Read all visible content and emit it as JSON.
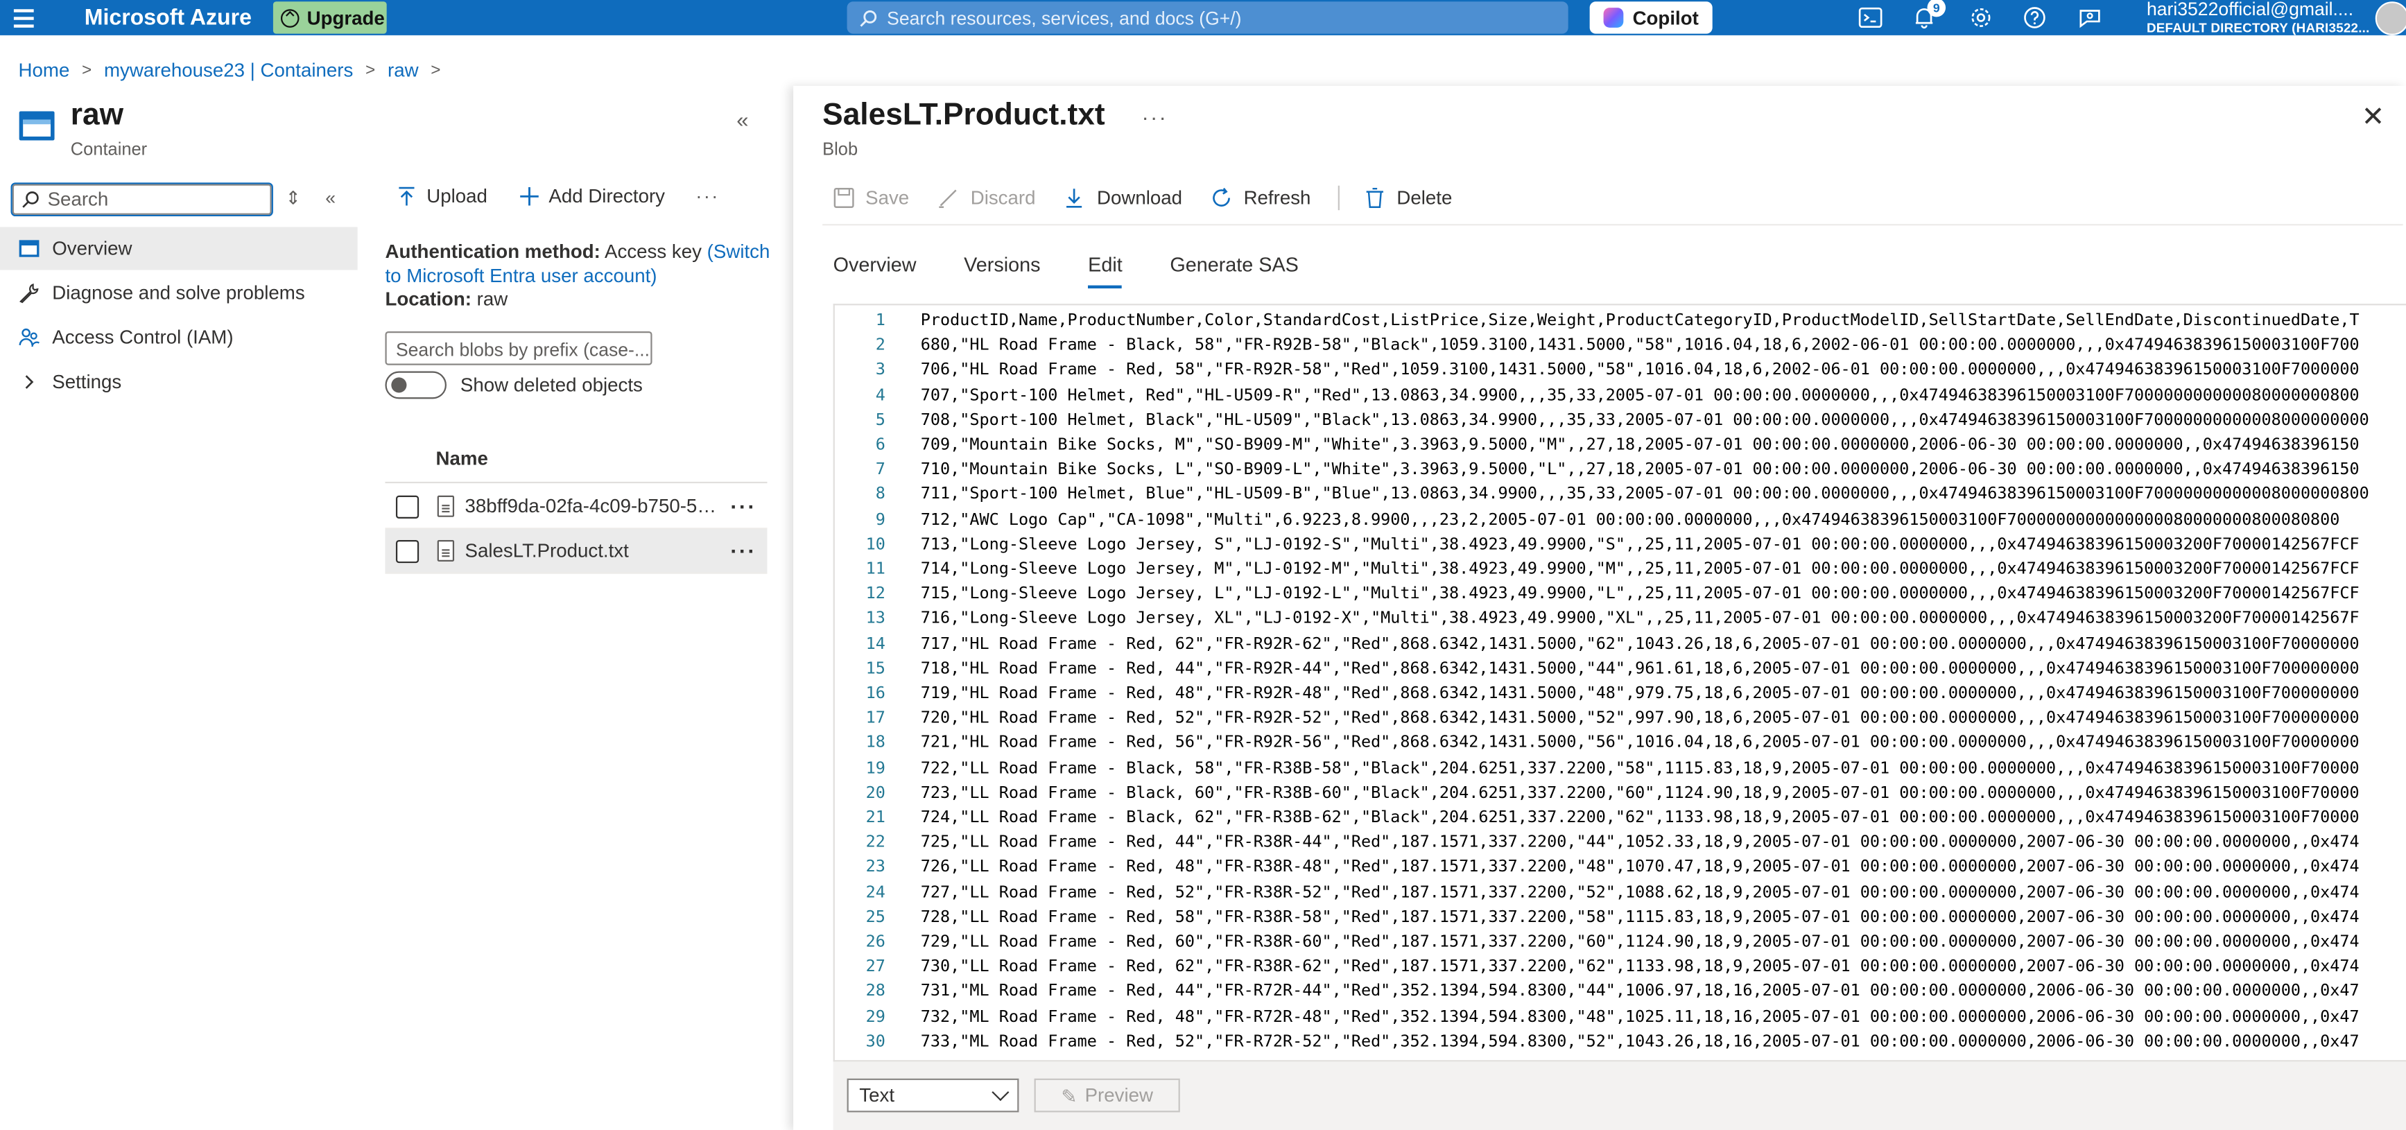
{
  "topbar": {
    "brand": "Microsoft Azure",
    "upgrade_label": "Upgrade",
    "search_placeholder": "Search resources, services, and docs (G+/)",
    "copilot_label": "Copilot",
    "notification_count": "9",
    "account_email": "hari3522official@gmail....",
    "account_directory": "DEFAULT DIRECTORY (HARI3522..."
  },
  "breadcrumb": [
    "Home",
    "mywarehouse23 | Containers",
    "raw"
  ],
  "container": {
    "title": "raw",
    "subtitle": "Container"
  },
  "leftnav": {
    "search_placeholder": "Search",
    "items": [
      {
        "label": "Overview",
        "icon": "container-icon"
      },
      {
        "label": "Diagnose and solve problems",
        "icon": "wrench-icon"
      },
      {
        "label": "Access Control (IAM)",
        "icon": "people-icon"
      },
      {
        "label": "Settings",
        "icon": "chevron-right-icon"
      }
    ]
  },
  "middle": {
    "upload_label": "Upload",
    "add_directory_label": "Add Directory",
    "auth_label": "Authentication method:",
    "auth_value": "Access key",
    "auth_link": "(Switch to Microsoft Entra user account)",
    "location_label": "Location:",
    "location_value": "raw",
    "blob_search_placeholder": "Search blobs by prefix (case-...",
    "show_deleted_label": "Show deleted objects",
    "list_header": "Name",
    "files": [
      {
        "name": "38bff9da-02fa-4c09-b750-5ee...",
        "selected": false
      },
      {
        "name": "SalesLT.Product.txt",
        "selected": true
      }
    ]
  },
  "blade": {
    "title": "SalesLT.Product.txt",
    "subtitle": "Blob",
    "toolbar": {
      "save": "Save",
      "discard": "Discard",
      "download": "Download",
      "refresh": "Refresh",
      "delete": "Delete"
    },
    "tabs": [
      "Overview",
      "Versions",
      "Edit",
      "Generate SAS"
    ],
    "active_tab": "Edit",
    "format_value": "Text",
    "preview_label": "Preview",
    "lines": [
      "ProductID,Name,ProductNumber,Color,StandardCost,ListPrice,Size,Weight,ProductCategoryID,ProductModelID,SellStartDate,SellEndDate,DiscontinuedDate,T",
      "680,\"HL Road Frame - Black, 58\",\"FR-R92B-58\",\"Black\",1059.3100,1431.5000,\"58\",1016.04,18,6,2002-06-01 00:00:00.0000000,,,0x47494638396150003100F700",
      "706,\"HL Road Frame - Red, 58\",\"FR-R92R-58\",\"Red\",1059.3100,1431.5000,\"58\",1016.04,18,6,2002-06-01 00:00:00.0000000,,,0x47494638396150003100F7000000",
      "707,\"Sport-100 Helmet, Red\",\"HL-U509-R\",\"Red\",13.0863,34.9900,,,35,33,2005-07-01 00:00:00.0000000,,,0x47494638396150003100F700000000000080000000800",
      "708,\"Sport-100 Helmet, Black\",\"HL-U509\",\"Black\",13.0863,34.9900,,,35,33,2005-07-01 00:00:00.0000000,,,0x47494638396150003100F70000000000008000000000",
      "709,\"Mountain Bike Socks, M\",\"SO-B909-M\",\"White\",3.3963,9.5000,\"M\",,27,18,2005-07-01 00:00:00.0000000,2006-06-30 00:00:00.0000000,,0x47494638396150",
      "710,\"Mountain Bike Socks, L\",\"SO-B909-L\",\"White\",3.3963,9.5000,\"L\",,27,18,2005-07-01 00:00:00.0000000,2006-06-30 00:00:00.0000000,,0x47494638396150",
      "711,\"Sport-100 Helmet, Blue\",\"HL-U509-B\",\"Blue\",13.0863,34.9900,,,35,33,2005-07-01 00:00:00.0000000,,,0x47494638396150003100F70000000000008000000800",
      "712,\"AWC Logo Cap\",\"CA-1098\",\"Multi\",6.9223,8.9900,,,23,2,2005-07-01 00:00:00.0000000,,,0x47494638396150003100F7000000000000000080000000800080800",
      "713,\"Long-Sleeve Logo Jersey, S\",\"LJ-0192-S\",\"Multi\",38.4923,49.9900,\"S\",,25,11,2005-07-01 00:00:00.0000000,,,0x47494638396150003200F70000142567FCF",
      "714,\"Long-Sleeve Logo Jersey, M\",\"LJ-0192-M\",\"Multi\",38.4923,49.9900,\"M\",,25,11,2005-07-01 00:00:00.0000000,,,0x47494638396150003200F70000142567FCF",
      "715,\"Long-Sleeve Logo Jersey, L\",\"LJ-0192-L\",\"Multi\",38.4923,49.9900,\"L\",,25,11,2005-07-01 00:00:00.0000000,,,0x47494638396150003200F70000142567FCF",
      "716,\"Long-Sleeve Logo Jersey, XL\",\"LJ-0192-X\",\"Multi\",38.4923,49.9900,\"XL\",,25,11,2005-07-01 00:00:00.0000000,,,0x47494638396150003200F70000142567F",
      "717,\"HL Road Frame - Red, 62\",\"FR-R92R-62\",\"Red\",868.6342,1431.5000,\"62\",1043.26,18,6,2005-07-01 00:00:00.0000000,,,0x47494638396150003100F70000000",
      "718,\"HL Road Frame - Red, 44\",\"FR-R92R-44\",\"Red\",868.6342,1431.5000,\"44\",961.61,18,6,2005-07-01 00:00:00.0000000,,,0x47494638396150003100F700000000",
      "719,\"HL Road Frame - Red, 48\",\"FR-R92R-48\",\"Red\",868.6342,1431.5000,\"48\",979.75,18,6,2005-07-01 00:00:00.0000000,,,0x47494638396150003100F700000000",
      "720,\"HL Road Frame - Red, 52\",\"FR-R92R-52\",\"Red\",868.6342,1431.5000,\"52\",997.90,18,6,2005-07-01 00:00:00.0000000,,,0x47494638396150003100F700000000",
      "721,\"HL Road Frame - Red, 56\",\"FR-R92R-56\",\"Red\",868.6342,1431.5000,\"56\",1016.04,18,6,2005-07-01 00:00:00.0000000,,,0x47494638396150003100F70000000",
      "722,\"LL Road Frame - Black, 58\",\"FR-R38B-58\",\"Black\",204.6251,337.2200,\"58\",1115.83,18,9,2005-07-01 00:00:00.0000000,,,0x47494638396150003100F70000",
      "723,\"LL Road Frame - Black, 60\",\"FR-R38B-60\",\"Black\",204.6251,337.2200,\"60\",1124.90,18,9,2005-07-01 00:00:00.0000000,,,0x47494638396150003100F70000",
      "724,\"LL Road Frame - Black, 62\",\"FR-R38B-62\",\"Black\",204.6251,337.2200,\"62\",1133.98,18,9,2005-07-01 00:00:00.0000000,,,0x47494638396150003100F70000",
      "725,\"LL Road Frame - Red, 44\",\"FR-R38R-44\",\"Red\",187.1571,337.2200,\"44\",1052.33,18,9,2005-07-01 00:00:00.0000000,2007-06-30 00:00:00.0000000,,0x474",
      "726,\"LL Road Frame - Red, 48\",\"FR-R38R-48\",\"Red\",187.1571,337.2200,\"48\",1070.47,18,9,2005-07-01 00:00:00.0000000,2007-06-30 00:00:00.0000000,,0x474",
      "727,\"LL Road Frame - Red, 52\",\"FR-R38R-52\",\"Red\",187.1571,337.2200,\"52\",1088.62,18,9,2005-07-01 00:00:00.0000000,2007-06-30 00:00:00.0000000,,0x474",
      "728,\"LL Road Frame - Red, 58\",\"FR-R38R-58\",\"Red\",187.1571,337.2200,\"58\",1115.83,18,9,2005-07-01 00:00:00.0000000,2007-06-30 00:00:00.0000000,,0x474",
      "729,\"LL Road Frame - Red, 60\",\"FR-R38R-60\",\"Red\",187.1571,337.2200,\"60\",1124.90,18,9,2005-07-01 00:00:00.0000000,2007-06-30 00:00:00.0000000,,0x474",
      "730,\"LL Road Frame - Red, 62\",\"FR-R38R-62\",\"Red\",187.1571,337.2200,\"62\",1133.98,18,9,2005-07-01 00:00:00.0000000,2007-06-30 00:00:00.0000000,,0x474",
      "731,\"ML Road Frame - Red, 44\",\"FR-R72R-44\",\"Red\",352.1394,594.8300,\"44\",1006.97,18,16,2005-07-01 00:00:00.0000000,2006-06-30 00:00:00.0000000,,0x47",
      "732,\"ML Road Frame - Red, 48\",\"FR-R72R-48\",\"Red\",352.1394,594.8300,\"48\",1025.11,18,16,2005-07-01 00:00:00.0000000,2006-06-30 00:00:00.0000000,,0x47",
      "733,\"ML Road Frame - Red, 52\",\"FR-R72R-52\",\"Red\",352.1394,594.8300,\"52\",1043.26,18,16,2005-07-01 00:00:00.0000000,2006-06-30 00:00:00.0000000,,0x47"
    ]
  }
}
